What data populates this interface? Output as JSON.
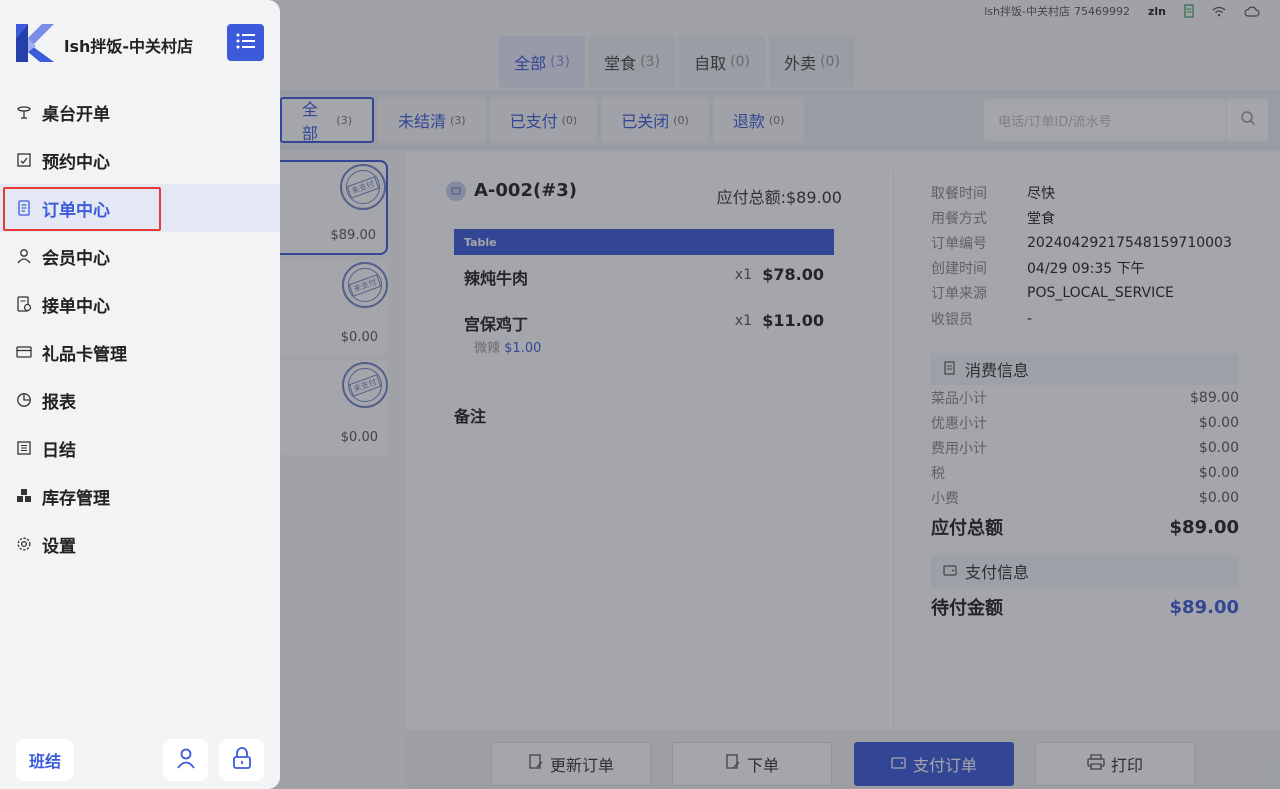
{
  "status_bar": {
    "store": "lsh拌饭-中关村店",
    "store_id": "75469992",
    "user": "zln"
  },
  "type_tabs": [
    {
      "label": "全部",
      "count": "(3)"
    },
    {
      "label": "堂食",
      "count": "(3)"
    },
    {
      "label": "自取",
      "count": "(0)"
    },
    {
      "label": "外卖",
      "count": "(0)"
    }
  ],
  "status_tabs": [
    {
      "label": "全部",
      "count": "(3)"
    },
    {
      "label": "未结清",
      "count": "(3)"
    },
    {
      "label": "已支付",
      "count": "(0)"
    },
    {
      "label": "已关闭",
      "count": "(0)"
    },
    {
      "label": "退款",
      "count": "(0)"
    }
  ],
  "search": {
    "placeholder": "电话/订单ID/流水号"
  },
  "orders": [
    {
      "amount": "$89.00",
      "stamp": "未支付"
    },
    {
      "amount": "$0.00",
      "stamp": "未支付"
    },
    {
      "amount": "$0.00",
      "stamp": "未支付"
    }
  ],
  "detail": {
    "order_no": "A-002(#3)",
    "total_label": "应付总额:$89.00",
    "table_header": "Table",
    "items": [
      {
        "name": "辣炖牛肉",
        "qty": "x1",
        "price": "$78.00"
      },
      {
        "name": "宫保鸡丁",
        "qty": "x1",
        "price": "$11.00",
        "modifier": "微辣",
        "modifier_price": "$1.00"
      }
    ],
    "remark_label": "备注"
  },
  "info": {
    "rows": [
      {
        "k": "取餐时间",
        "v": "尽快"
      },
      {
        "k": "用餐方式",
        "v": "堂食"
      },
      {
        "k": "订单编号",
        "v": "20240429217548159710003"
      },
      {
        "k": "创建时间",
        "v": "04/29 09:35 下午"
      },
      {
        "k": "订单来源",
        "v": "POS_LOCAL_SERVICE"
      },
      {
        "k": "收银员",
        "v": "-"
      }
    ],
    "consume_title": "消费信息",
    "summary": [
      {
        "k": "菜品小计",
        "v": "$89.00"
      },
      {
        "k": "优惠小计",
        "v": "$0.00"
      },
      {
        "k": "费用小计",
        "v": "$0.00"
      },
      {
        "k": "税",
        "v": "$0.00"
      },
      {
        "k": "小费",
        "v": "$0.00"
      }
    ],
    "total": {
      "k": "应付总额",
      "v": "$89.00"
    },
    "pay_title": "支付信息",
    "pending": {
      "k": "待付金额",
      "v": "$89.00"
    }
  },
  "footer_buttons": [
    "更新订单",
    "下单",
    "支付订单",
    "打印"
  ],
  "sidebar": {
    "brand": "lsh拌饭-中关村店",
    "items": [
      {
        "label": "桌台开单"
      },
      {
        "label": "预约中心"
      },
      {
        "label": "订单中心"
      },
      {
        "label": "会员中心"
      },
      {
        "label": "接单中心"
      },
      {
        "label": "礼品卡管理"
      },
      {
        "label": "报表"
      },
      {
        "label": "日结"
      },
      {
        "label": "库存管理"
      },
      {
        "label": "设置"
      }
    ],
    "shift_label": "班结"
  },
  "colors": {
    "accent": "#3b5bdb",
    "highlight": "#e53935"
  }
}
